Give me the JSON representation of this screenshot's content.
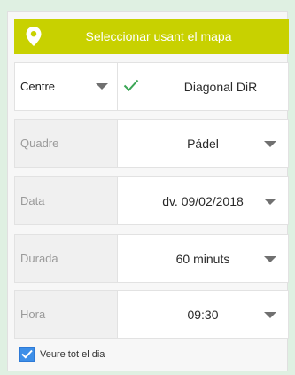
{
  "map_button": {
    "label": "Seleccionar usant el mapa",
    "icon": "location-pin-icon"
  },
  "fields": [
    {
      "label": "Centre",
      "value": "Diagonal DiR"
    },
    {
      "label": "Quadre",
      "value": "Pádel"
    },
    {
      "label": "Data",
      "value": "dv. 09/02/2018"
    },
    {
      "label": "Durada",
      "value": "60 minuts"
    },
    {
      "label": "Hora",
      "value": "09:30"
    }
  ],
  "show_all_day": {
    "label": "Veure tot el dia",
    "checked": true
  },
  "colors": {
    "accent": "#c8d100",
    "checkbox": "#3d8fe8",
    "check_mark": "#3aa655"
  }
}
